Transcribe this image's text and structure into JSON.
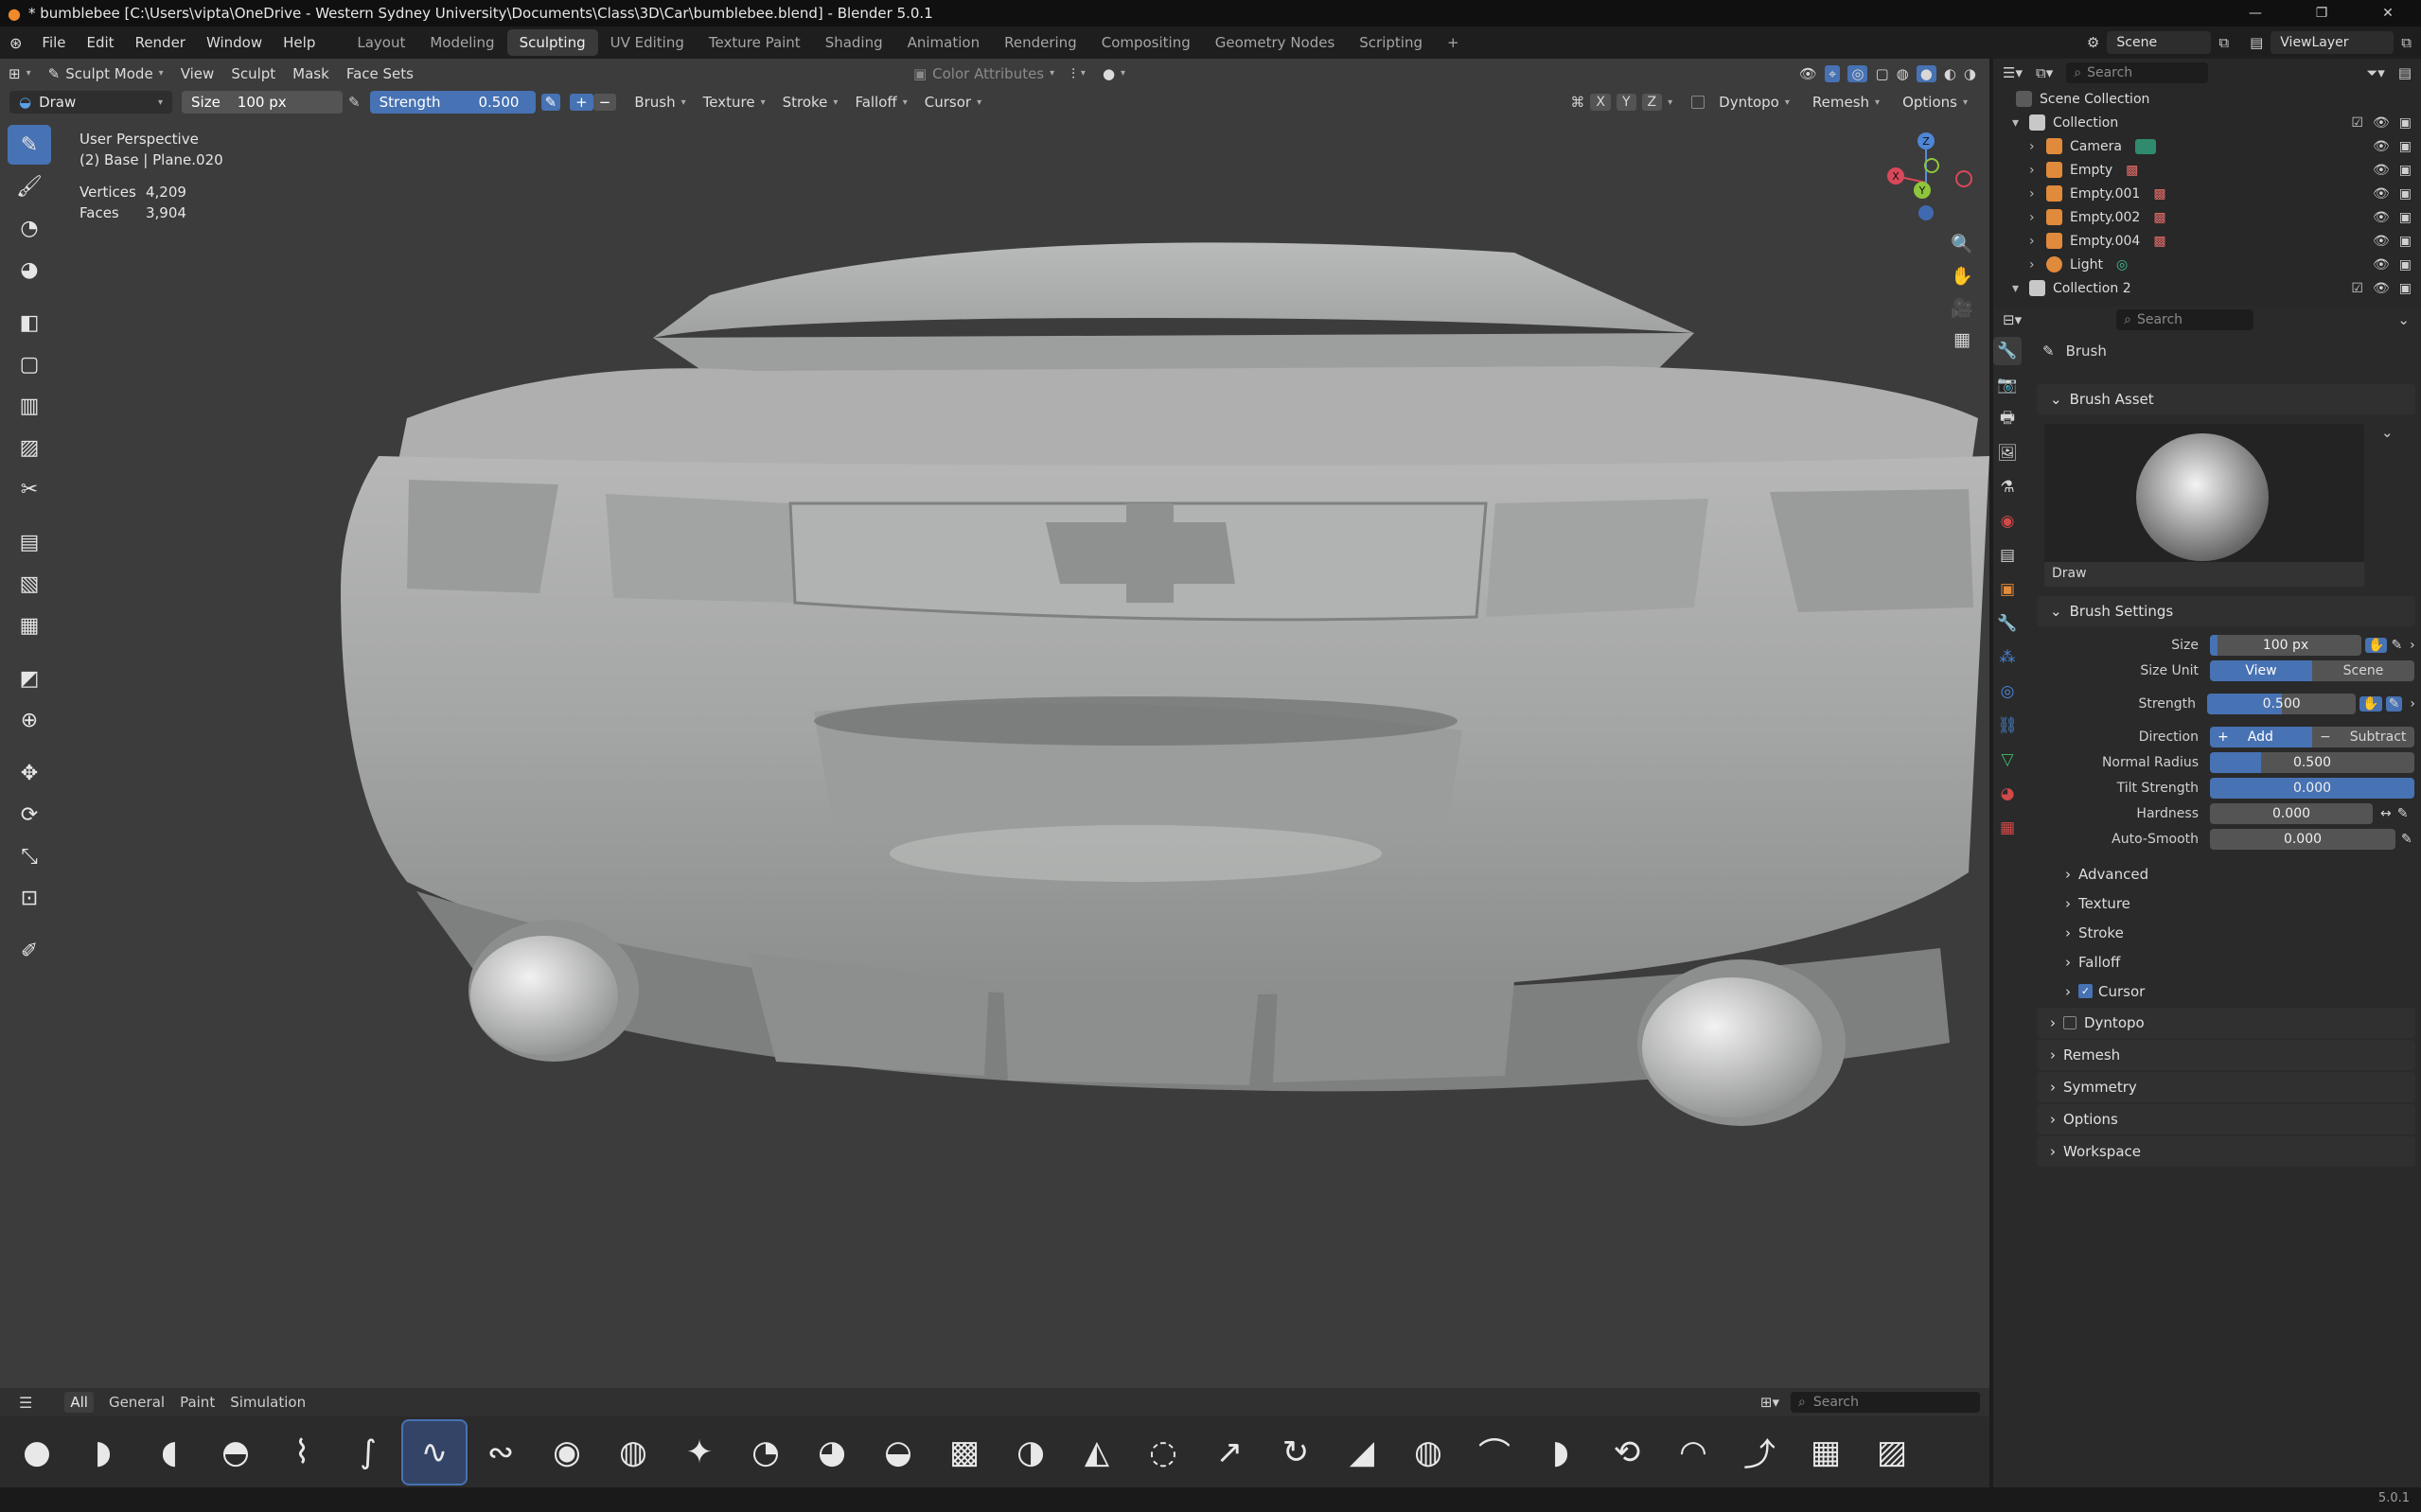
{
  "window": {
    "title": "* bumblebee [C:\\Users\\vipta\\OneDrive - Western Sydney University\\Documents\\Class\\3D\\Car\\bumblebee.blend] - Blender 5.0.1",
    "controls": [
      "—",
      "❐",
      "✕"
    ]
  },
  "menubar": {
    "menus": [
      "File",
      "Edit",
      "Render",
      "Window",
      "Help"
    ],
    "workspaces": [
      "Layout",
      "Modeling",
      "Sculpting",
      "UV Editing",
      "Texture Paint",
      "Shading",
      "Animation",
      "Rendering",
      "Compositing",
      "Geometry Nodes",
      "Scripting"
    ],
    "active_workspace": "Sculpting",
    "add_label": "+",
    "scene": "Scene",
    "view_layer": "ViewLayer"
  },
  "viewport_header": {
    "mode": "Sculpt Mode",
    "menus": [
      "View",
      "Sculpt",
      "Mask",
      "Face Sets"
    ],
    "color_attributes": "Color Attributes"
  },
  "tool_header": {
    "brush": "Draw",
    "size_label": "Size",
    "size_value": "100 px",
    "strength_label": "Strength",
    "strength_value": "0.500",
    "plus": "+",
    "minus": "−",
    "menus": [
      "Brush",
      "Texture",
      "Stroke",
      "Falloff",
      "Cursor"
    ],
    "axes": [
      "X",
      "Y",
      "Z"
    ],
    "dyntopo": "Dyntopo",
    "remesh": "Remesh",
    "options": "Options"
  },
  "overlay": {
    "view_name": "User Perspective",
    "object": "(2) Base | Plane.020",
    "vertices_label": "Vertices",
    "vertices_value": "4,209",
    "faces_label": "Faces",
    "faces_value": "3,904"
  },
  "gizmo": {
    "z": "Z",
    "y": "Y",
    "x": "X"
  },
  "asset_shelf": {
    "tabs": [
      "All",
      "General",
      "Paint",
      "Simulation"
    ],
    "active_tab": "All",
    "search_placeholder": "Search"
  },
  "outliner": {
    "search_placeholder": "Search",
    "root": "Scene Collection",
    "items": [
      {
        "name": "Collection",
        "type": "collection",
        "color": "#b8b8b8"
      },
      {
        "name": "Camera",
        "type": "camera",
        "color": "#e08a3c"
      },
      {
        "name": "Empty",
        "type": "empty",
        "color": "#e08a3c"
      },
      {
        "name": "Empty.001",
        "type": "empty",
        "color": "#e08a3c"
      },
      {
        "name": "Empty.002",
        "type": "empty",
        "color": "#e08a3c"
      },
      {
        "name": "Empty.004",
        "type": "empty",
        "color": "#e08a3c"
      },
      {
        "name": "Light",
        "type": "light",
        "color": "#e08a3c"
      },
      {
        "name": "Collection 2",
        "type": "collection",
        "color": "#b8b8b8"
      }
    ]
  },
  "properties": {
    "search_placeholder": "Search",
    "context": "Brush",
    "brush_asset_title": "Brush Asset",
    "brush_asset_name": "Draw",
    "brush_settings_title": "Brush Settings",
    "size_label": "Size",
    "size_value": "100 px",
    "size_fraction": 0.05,
    "size_unit_label": "Size Unit",
    "size_unit_view": "View",
    "size_unit_scene": "Scene",
    "strength_label": "Strength",
    "strength_value": "0.500",
    "strength_fraction": 0.5,
    "direction_label": "Direction",
    "direction_add": "Add",
    "direction_subtract": "Subtract",
    "normal_radius_label": "Normal Radius",
    "normal_radius_value": "0.500",
    "normal_radius_fraction": 0.25,
    "tilt_label": "Tilt Strength",
    "tilt_value": "0.000",
    "hardness_label": "Hardness",
    "hardness_value": "0.000",
    "autosmooth_label": "Auto-Smooth",
    "autosmooth_value": "0.000",
    "sub_panels": [
      "Advanced",
      "Texture",
      "Stroke",
      "Falloff"
    ],
    "cursor_label": "Cursor",
    "panels": [
      "Dyntopo",
      "Remesh",
      "Symmetry",
      "Options",
      "Workspace"
    ]
  },
  "status": {
    "version": "5.0.1"
  },
  "colors": {
    "accent": "#4772b3",
    "viewport_bg": "#3c3c3c",
    "panel_bg": "#2a2a2a",
    "car_body": "#a9aaa9"
  }
}
